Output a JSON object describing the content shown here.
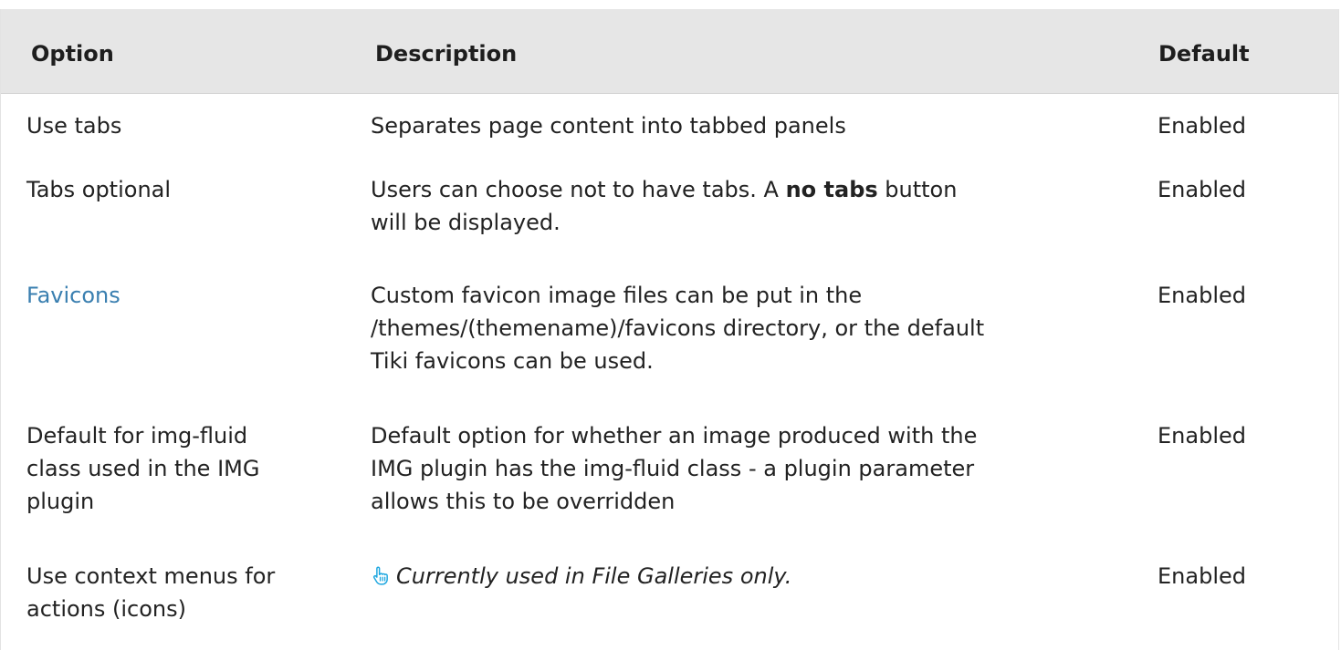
{
  "headers": {
    "option": "Option",
    "description": "Description",
    "default": "Default"
  },
  "rows": [
    {
      "option": "Use tabs",
      "description": "Separates page content into tabbed panels",
      "default": "Enabled"
    },
    {
      "option": "Tabs optional",
      "description_line1_pre": "Users can choose not to have tabs. A ",
      "description_bold": "no tabs",
      "description_line1_post": " button",
      "description_line2": "will be displayed.",
      "default": "Enabled"
    },
    {
      "option": "Favicons",
      "description_line1": "Custom favicon image files can be put in the",
      "description_line2": "/themes/(themename)/favicons directory, or the default",
      "description_line3": "Tiki favicons can be used.",
      "default": "Enabled"
    },
    {
      "option_line1": "Default for img-fluid",
      "option_line2": "class used in the IMG",
      "option_line3": "plugin",
      "description_line1": "Default option for whether an image produced with the",
      "description_line2": "IMG plugin has the img-fluid class - a plugin parameter",
      "description_line3": "allows this to be overridden",
      "default": "Enabled"
    },
    {
      "option_line1": "Use context menus for",
      "option_line2": "actions (icons)",
      "description": "Currently used in File Galleries only.",
      "description_icon": "hand-pointer-icon",
      "default": "Enabled"
    }
  ],
  "colors": {
    "header_bg": "#e6e6e6",
    "link": "#3a7fb0",
    "icon": "#1ea7e0"
  }
}
